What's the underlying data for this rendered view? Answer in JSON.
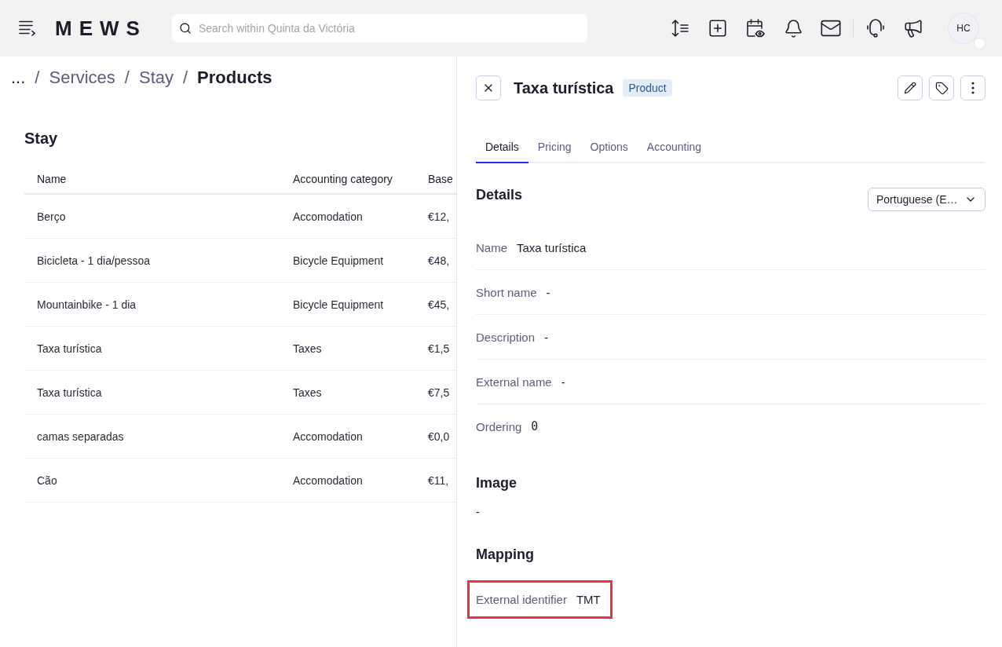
{
  "top_bar": {
    "logo": "MEWS",
    "search": {
      "placeholder": "Search within Quinta da Victória"
    },
    "avatar": {
      "initials": "HC"
    }
  },
  "breadcrumb": [
    {
      "label": "...",
      "kind": "overflow"
    },
    {
      "separator": "/",
      "label": "Services",
      "kind": "link"
    },
    {
      "separator": "/",
      "label": "Stay",
      "kind": "link"
    },
    {
      "separator": "/",
      "label": "Products",
      "kind": "current"
    }
  ],
  "list": {
    "title": "Stay",
    "table": {
      "columns": [
        "Name",
        "Accounting category",
        "Base"
      ],
      "rows": [
        [
          "Berço",
          "Accomodation",
          "€12,"
        ],
        [
          "Bicicleta - 1 dia/pessoa",
          "Bicycle Equipment",
          "€48,"
        ],
        [
          "Mountainbike - 1 dia",
          "Bicycle Equipment",
          "€45,"
        ],
        [
          "Taxa turística",
          "Taxes",
          "€1,5"
        ],
        [
          "Taxa turística",
          "Taxes",
          "€7,5"
        ],
        [
          "camas separadas",
          "Accomodation",
          "€0,0"
        ],
        [
          "Cão",
          "Accomodation",
          "€11,"
        ]
      ]
    }
  },
  "panel": {
    "title": "Taxa turística",
    "badge": "Product",
    "tabs": [
      {
        "label": "Details",
        "selected": true
      },
      {
        "label": "Pricing",
        "selected": false
      },
      {
        "label": "Options",
        "selected": false
      },
      {
        "label": "Accounting",
        "selected": false
      }
    ],
    "details": {
      "title": "Details",
      "language": "Portuguese (E…",
      "fields": [
        {
          "label": "Name",
          "value": "Taxa turística",
          "kind": "text"
        },
        {
          "label": "Short name",
          "value": "-",
          "kind": "text"
        },
        {
          "label": "Description",
          "value": "-",
          "kind": "text"
        },
        {
          "label": "External name",
          "value": "-",
          "kind": "text"
        },
        {
          "label": "Ordering",
          "value": "0",
          "kind": "number"
        }
      ]
    },
    "image": {
      "title": "Image",
      "value": "-"
    },
    "mapping": {
      "title": "Mapping",
      "fields": [
        {
          "label": "External identifier",
          "value": "TMT",
          "highlighted": true
        }
      ]
    }
  }
}
